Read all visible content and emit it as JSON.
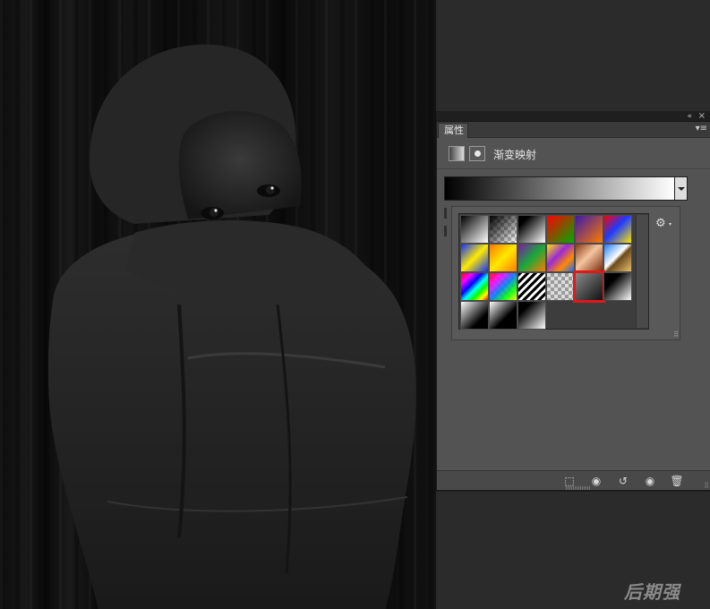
{
  "panel": {
    "tab_label": "属性",
    "adjustment_title": "渐变映射",
    "collapse_icon": "«",
    "close_icon": "×",
    "menu_icon": "▾≡"
  },
  "gradient": {
    "preview_from": "#000000",
    "preview_to": "#ffffff"
  },
  "picker": {
    "gear_glyph": "⚙",
    "gear_arrow": "▾",
    "resize_glyph": "⠿",
    "swatches": [
      {
        "name": "foreground-to-background",
        "css": "linear-gradient(135deg,#000 0%,#fff 100%)"
      },
      {
        "name": "foreground-to-transparent",
        "css": "linear-gradient(135deg,#000 0%,rgba(0,0,0,0) 100%),repeating-conic-gradient(#bbb 0 25%,#fff 0 50%) 0 0/8px 8px"
      },
      {
        "name": "black-white",
        "css": "linear-gradient(135deg,#000 20%,#fff 100%)"
      },
      {
        "name": "red-green",
        "css": "linear-gradient(135deg,#ff0000 0%,#00aa00 100%)"
      },
      {
        "name": "violet-orange",
        "css": "linear-gradient(135deg,#3d1aa8 0%,#ff7a00 100%)"
      },
      {
        "name": "blue-red-yellow",
        "css": "linear-gradient(135deg,#ff0000 0%,#1d3bff 45%,#ffe600 100%)"
      },
      {
        "name": "blue-yellow-blue",
        "css": "linear-gradient(135deg,#1030ff 0%,#ffea00 50%,#1030ff 100%)"
      },
      {
        "name": "orange-yellow-orange",
        "css": "linear-gradient(135deg,#ff7a00 0%,#ffe800 50%,#ff7a00 100%)"
      },
      {
        "name": "violet-green-orange",
        "css": "linear-gradient(135deg,#7a1aa8 0%,#1aa83a 50%,#ff7a00 100%)"
      },
      {
        "name": "yellow-violet-orange-blue",
        "css": "linear-gradient(135deg,#ffe600 0%,#9b2ad6 40%,#ff8a00 70%,#1a6bff 100%)"
      },
      {
        "name": "copper",
        "css": "linear-gradient(135deg,#8a3a12 0%,#f4c4a0 45%,#7a2a0a 100%)"
      },
      {
        "name": "chrome",
        "css": "linear-gradient(135deg,#1a7aff 0%,#ffffff 45%,#6b4a1a 55%,#e8c070 100%)"
      },
      {
        "name": "spectrum",
        "css": "linear-gradient(135deg,#ff0000 0%,#ff00ff 20%,#0000ff 40%,#00ffff 55%,#00ff00 70%,#ffff00 85%,#ff0000 100%)"
      },
      {
        "name": "transparent-rainbow",
        "css": "linear-gradient(135deg,rgba(255,0,0,0.9) 0%,rgba(255,0,255,0.9) 25%,rgba(0,120,255,0.9) 50%,rgba(0,255,0,0.9) 75%,rgba(255,255,0,0.9) 100%),repeating-conic-gradient(#bbb 0 25%,#fff 0 50%) 0 0/8px 8px"
      },
      {
        "name": "transparent-stripes",
        "css": "repeating-linear-gradient(135deg,#000 0 3px,#fff 3px 6px)"
      },
      {
        "name": "transparent-checker",
        "css": "repeating-conic-gradient(#9a9a9a 0 25%,#dcdcdc 0 50%) 0 0/8px 8px"
      },
      {
        "name": "dark-gradient-selected",
        "css": "linear-gradient(135deg,#8a8a8a 0%,#111 100%)"
      },
      {
        "name": "black-to-white-diag",
        "css": "linear-gradient(135deg,#000 30%,#fff 100%)"
      },
      {
        "name": "white-black-a",
        "css": "linear-gradient(135deg,#fff 0%,#000 70%)"
      },
      {
        "name": "white-black-b",
        "css": "linear-gradient(135deg,#fff 0%,#000 60%)"
      },
      {
        "name": "white-black-c",
        "css": "linear-gradient(135deg,#000 25%,#fff 100%)"
      }
    ],
    "selected_index": 16
  },
  "footer": {
    "clip_glyph": "⬚",
    "view_prev_glyph": "◉",
    "reset_glyph": "↺",
    "visibility_glyph": "◉",
    "delete_glyph": "🗑",
    "resize_glyph": "⠿"
  },
  "watermark": "后期强"
}
